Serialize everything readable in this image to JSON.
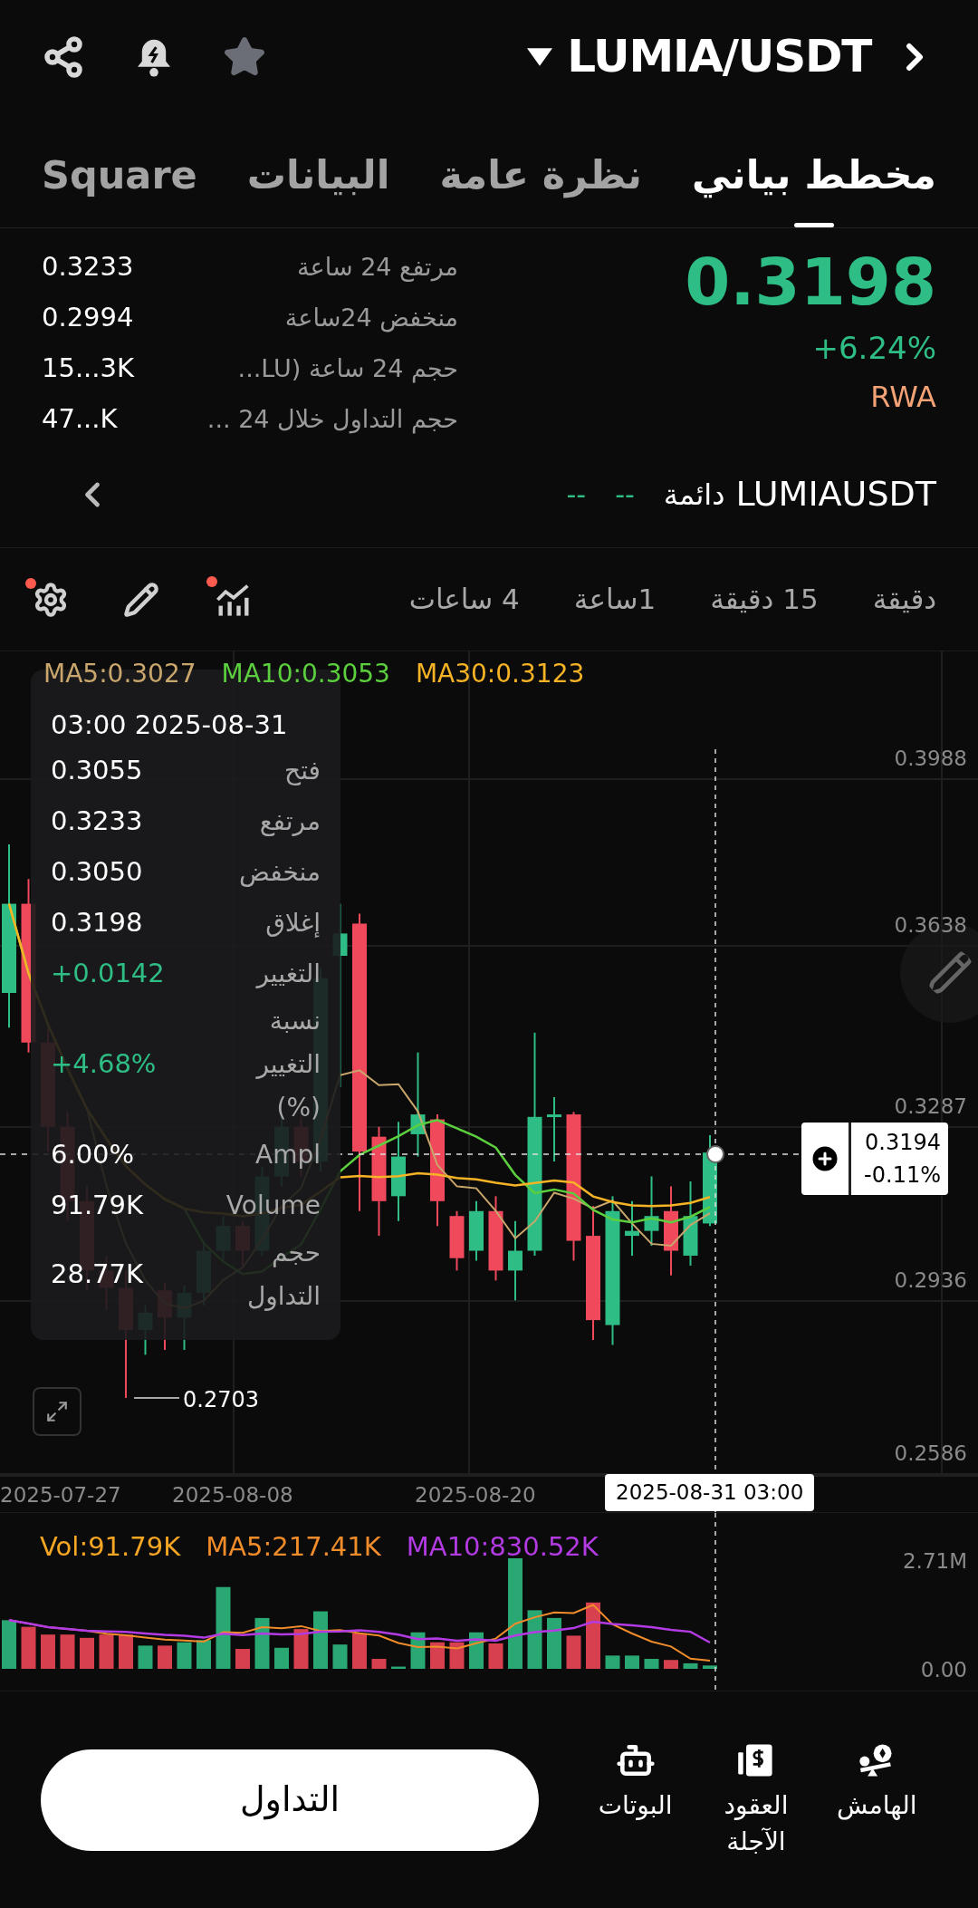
{
  "header": {
    "pair": "LUMIA/USDT"
  },
  "tabs": [
    {
      "label": "مخطط بياني",
      "selected": true
    },
    {
      "label": "نظرة عامة",
      "selected": false
    },
    {
      "label": "البيانات",
      "selected": false
    },
    {
      "label": "Square",
      "selected": false
    }
  ],
  "price": {
    "last": "0.3198",
    "change": "+6.24%",
    "tag": "RWA"
  },
  "stats": [
    {
      "label": "مرتفع 24 ساعة",
      "value": "0.3233"
    },
    {
      "label": "منخفض 24ساعة",
      "value": "0.2994"
    },
    {
      "label": "حجم 24 ساعة (LU...",
      "value": "15...3K"
    },
    {
      "label": "حجم التداول خلال 24 ...",
      "value": "47...K"
    }
  ],
  "contract": {
    "symbol": "LUMIAUSDT",
    "type": "دائمة",
    "values": [
      "--",
      "--"
    ]
  },
  "intervals": [
    {
      "label": "دقيقة",
      "selected": false
    },
    {
      "label": "15 دقيقة",
      "selected": false
    },
    {
      "label": "1ساعة",
      "selected": false
    },
    {
      "label": "4 ساعات",
      "selected": false
    }
  ],
  "tools": [
    {
      "kind": "indicators",
      "dot": true
    },
    {
      "kind": "draw",
      "dot": false
    },
    {
      "kind": "settings",
      "dot": true
    }
  ],
  "chart": {
    "ma": [
      {
        "label": "MA30:0.3123",
        "color": "#f5b325"
      },
      {
        "label": "MA10:0.3053",
        "color": "#5ccf3e"
      },
      {
        "label": "MA5:0.3027",
        "color": "#c9a66b"
      }
    ],
    "y_labels": [
      "0.3988",
      "0.3638",
      "0.3287",
      "0.2936",
      "0.2586"
    ],
    "x_labels": [
      "2025-08-20",
      "2025-08-08",
      "2025-07-27"
    ],
    "crosshair_time": "2025-08-31 03:00",
    "low_label": "0.2703",
    "price_tag": {
      "price": "0.3194",
      "change": "-0.11%"
    },
    "tooltip": {
      "time": "03:00 2025-08-31",
      "rows": [
        {
          "label": "فتح",
          "value": "0.3055",
          "kind": "plain"
        },
        {
          "label": "مرتفع",
          "value": "0.3233",
          "kind": "plain"
        },
        {
          "label": "منخفض",
          "value": "0.3050",
          "kind": "plain"
        },
        {
          "label": "إغلاق",
          "value": "0.3198",
          "kind": "plain"
        },
        {
          "label": "التغيير",
          "value": "+0.0142",
          "kind": "up"
        },
        {
          "label": "نسبة التغيير (%)",
          "value": "+4.68%",
          "kind": "up"
        },
        {
          "label": "Ampl",
          "value": "6.00%",
          "kind": "plain"
        },
        {
          "label": "Volume",
          "value": "91.79K",
          "kind": "plain"
        },
        {
          "label": "حجم التداول",
          "value": "28.77K",
          "kind": "plain"
        }
      ]
    }
  },
  "volume": {
    "legend": [
      {
        "label": "MA10:830.52K",
        "color": "#b33be3"
      },
      {
        "label": "MA5:217.41K",
        "color": "#f08c2a"
      },
      {
        "label": "Vol:91.79K",
        "color": "#f5a623"
      }
    ],
    "y_labels": [
      "2.71M",
      "0.00"
    ]
  },
  "bottom_nav": [
    {
      "kind": "margin",
      "label": "الهامش"
    },
    {
      "kind": "futures",
      "label": "العقود الآجلة"
    },
    {
      "kind": "bots",
      "label": "البوتات"
    }
  ],
  "trade_button": "التداول"
}
